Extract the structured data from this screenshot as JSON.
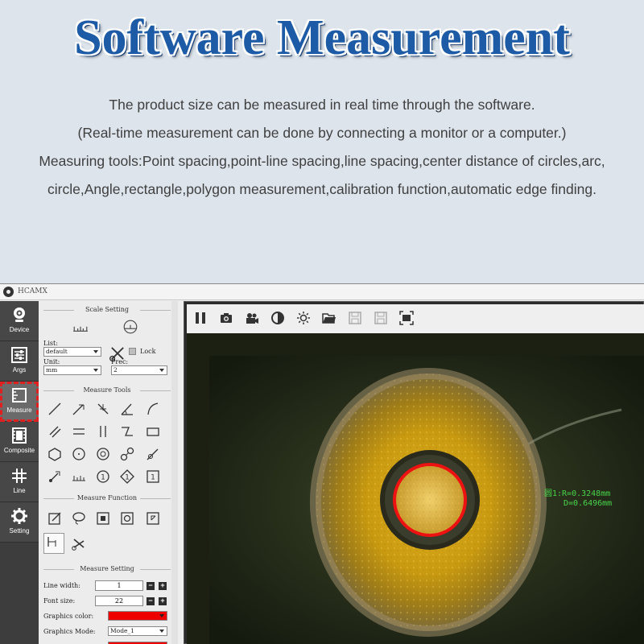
{
  "hero": {
    "title": "Software Measurement",
    "lines": [
      "The product size can be measured in real time through the software.",
      "(Real-time measurement can be done by connecting a monitor or a computer.)",
      "Measuring tools:Point spacing,point-line spacing,line spacing,center distance of circles,arc,",
      "circle,Angle,rectangle,polygon measurement,calibration function,automatic edge finding."
    ]
  },
  "app": {
    "name": "HCAMX"
  },
  "nav": [
    {
      "label": "Device",
      "icon": "webcam-icon"
    },
    {
      "label": "Args",
      "icon": "sliders-icon"
    },
    {
      "label": "Measure",
      "icon": "ruler-icon"
    },
    {
      "label": "Composite",
      "icon": "film-icon"
    },
    {
      "label": "Line",
      "icon": "grid-icon"
    },
    {
      "label": "Setting",
      "icon": "gear-icon"
    }
  ],
  "scale": {
    "title": "Scale Setting",
    "list_label": "List:",
    "list_value": "default",
    "lock_label": "Lock",
    "unit_label": "Unit:",
    "unit_value": "mm",
    "prec_label": "Prec:",
    "prec_value": "2"
  },
  "tools_title": "Measure Tools",
  "function_title": "Measure Function",
  "msetting": {
    "title": "Measure Setting",
    "line_width_label": "Line width:",
    "line_width": "1",
    "font_size_label": "Font size:",
    "font_size": "22",
    "graphics_color_label": "Graphics color:",
    "graphics_color": "#ee0000",
    "graphics_mode_label": "Graphics Mode:",
    "graphics_mode": "Mode_1"
  },
  "measurement": {
    "radius_text": "圆1:R=0.3248mm",
    "diameter_text": "D=0.6496mm"
  },
  "colors": {
    "accent": "#1d5ba6",
    "measure_green": "#48d44a",
    "circle_red": "#ee1111"
  }
}
